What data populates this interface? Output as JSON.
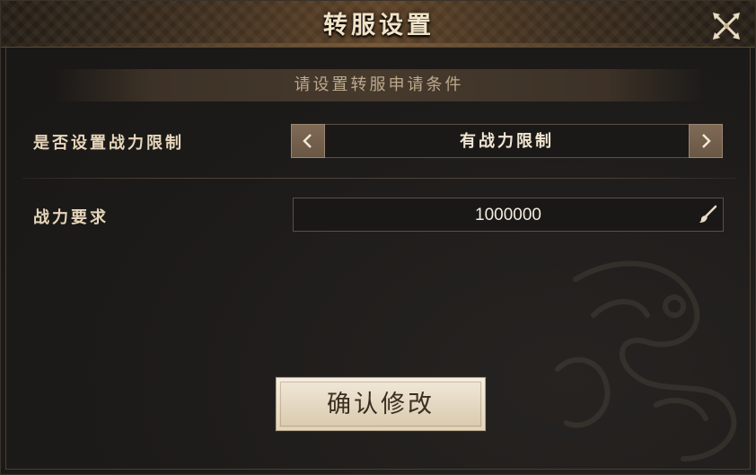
{
  "dialog": {
    "title": "转服设置",
    "close_icon": "crossed-swords-close-icon"
  },
  "banner": {
    "text": "请设置转服申请条件"
  },
  "limit_row": {
    "label": "是否设置战力限制",
    "selected_value": "有战力限制",
    "prev_icon": "chevron-left-icon",
    "next_icon": "chevron-right-icon"
  },
  "power_row": {
    "label": "战力要求",
    "value": "1000000",
    "edit_icon": "brush-icon"
  },
  "confirm": {
    "label": "确认修改"
  },
  "colors": {
    "panel_bg": "#1d1b19",
    "title_text": "#f1e3c8",
    "label_text": "#e6d6bb",
    "banner_text": "#bda98c",
    "selector_button": "#7e6a56",
    "confirm_button": "#e4d7c0",
    "confirm_text": "#3b2d20"
  }
}
